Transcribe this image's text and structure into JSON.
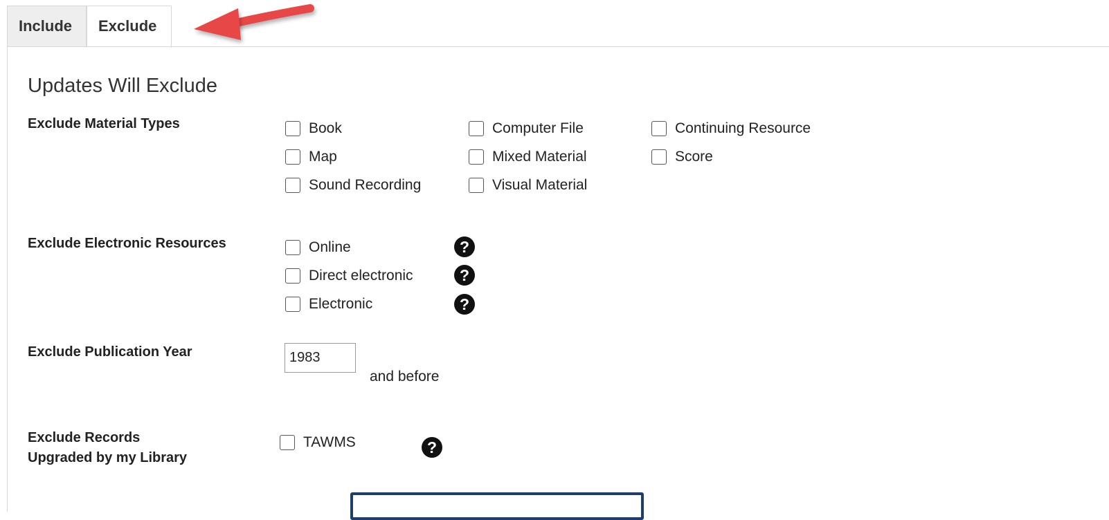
{
  "tabs": [
    {
      "label": "Include",
      "active": false
    },
    {
      "label": "Exclude",
      "active": true
    }
  ],
  "heading": "Updates Will Exclude",
  "material_types": {
    "label": "Exclude Material Types",
    "options": [
      {
        "label": "Book",
        "checked": false
      },
      {
        "label": "Computer File",
        "checked": false
      },
      {
        "label": "Continuing Resource",
        "checked": false
      },
      {
        "label": "Map",
        "checked": false
      },
      {
        "label": "Mixed Material",
        "checked": false
      },
      {
        "label": "Score",
        "checked": false
      },
      {
        "label": "Sound Recording",
        "checked": false
      },
      {
        "label": "Visual Material",
        "checked": false
      }
    ]
  },
  "electronic_resources": {
    "label": "Exclude Electronic Resources",
    "options": [
      {
        "label": "Online",
        "checked": false,
        "help_icon": "question-circle-icon"
      },
      {
        "label": "Direct electronic",
        "checked": false,
        "help_icon": "question-circle-icon"
      },
      {
        "label": "Electronic",
        "checked": false,
        "help_icon": "question-circle-icon"
      }
    ]
  },
  "publication_year": {
    "label": "Exclude Publication Year",
    "value": "1983",
    "suffix": "and before"
  },
  "upgraded_records": {
    "label_line1": "Exclude Records",
    "label_line2": "Upgraded by my Library",
    "options": [
      {
        "label": "TAWMS",
        "checked": false,
        "help_icon": "question-circle-icon"
      }
    ]
  },
  "colors": {
    "annotation_arrow": "#e84646",
    "button_border": "#1f3d6b"
  }
}
